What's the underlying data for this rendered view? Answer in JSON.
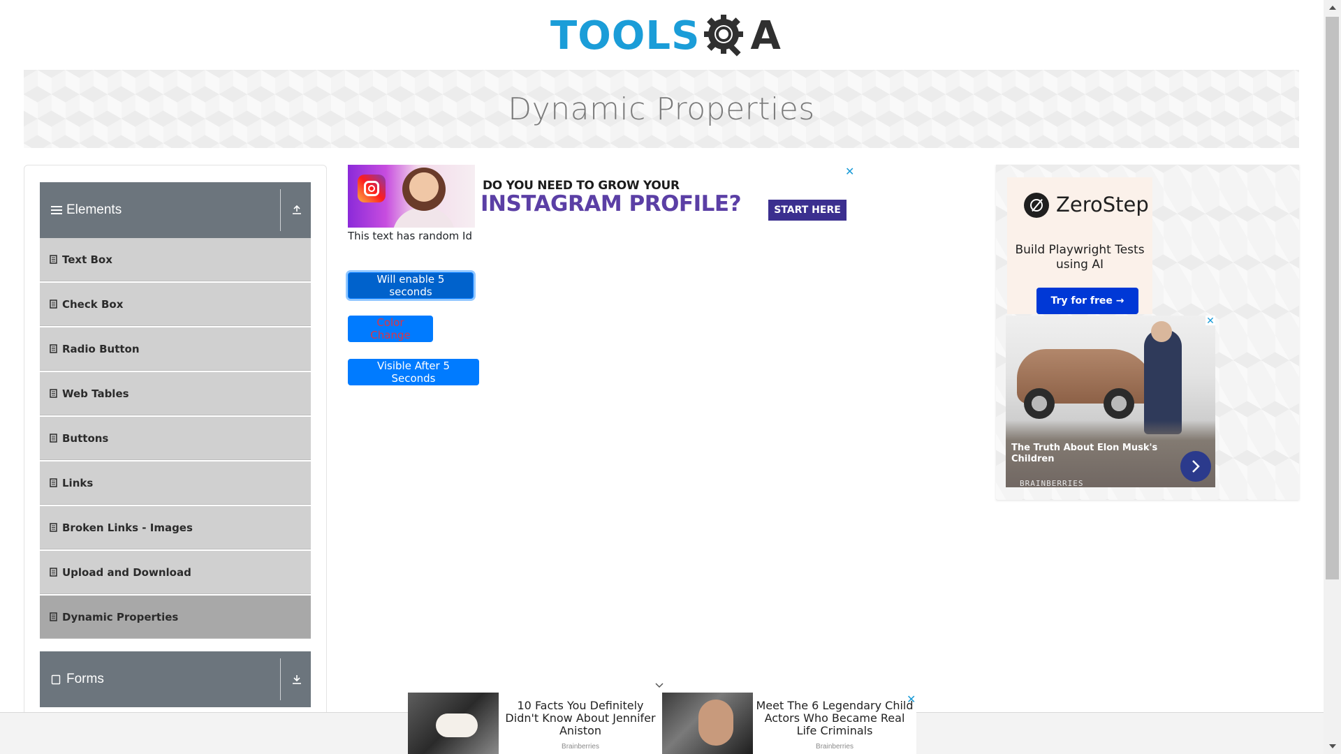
{
  "header": {
    "logo_tools": "TOOLS",
    "logo_qa_a": "A"
  },
  "banner": {
    "title": "Dynamic Properties"
  },
  "sidebar": {
    "elements_group": {
      "title": "Elements",
      "icon": "hamburger-icon",
      "toggle_icon": "collapse-up-icon"
    },
    "items": [
      {
        "label": "Text Box",
        "icon": "file-icon",
        "active": false
      },
      {
        "label": "Check Box",
        "icon": "file-icon",
        "active": false
      },
      {
        "label": "Radio Button",
        "icon": "file-icon",
        "active": false
      },
      {
        "label": "Web Tables",
        "icon": "file-icon",
        "active": false
      },
      {
        "label": "Buttons",
        "icon": "file-icon",
        "active": false
      },
      {
        "label": "Links",
        "icon": "file-icon",
        "active": false
      },
      {
        "label": "Broken Links - Images",
        "icon": "file-icon",
        "active": false
      },
      {
        "label": "Upload and Download",
        "icon": "file-icon",
        "active": false
      },
      {
        "label": "Dynamic Properties",
        "icon": "file-icon",
        "active": true
      }
    ],
    "forms_group": {
      "title": "Forms",
      "icon": "forms-icon",
      "toggle_icon": "expand-down-icon"
    }
  },
  "main": {
    "ad_top": {
      "small_text": "DO YOU NEED TO GROW YOUR",
      "big_text": "INSTAGRAM PROFILE?",
      "cta": "START HERE",
      "close": "✕"
    },
    "random_id_text": "This text has random Id",
    "buttons": {
      "enable_after": "Will enable 5 seconds",
      "color_change": "Color Change",
      "visible_after": "Visible After 5 Seconds"
    }
  },
  "right_ad": {
    "zerostep_name": "ZeroStep",
    "zerostep_tagline": "Build Playwright Tests using AI",
    "zerostep_cta": "Try for free →",
    "story_caption": "The Truth About Elon Musk's Children",
    "story_source": "BRAINBERRIES",
    "close": "✕"
  },
  "bottom_ad": {
    "tile1_title": "10 Facts You Definitely Didn't Know About Jennifer Aniston",
    "tile1_source": "Brainberries",
    "tile2_title": "Meet The 6 Legendary Child Actors Who Became Real Life Criminals",
    "tile2_source": "Brainberries",
    "close": "✕"
  },
  "colors": {
    "primary": "#007bff",
    "primary_active": "#0062cc",
    "danger_text": "#dc3545",
    "sidebar_header": "#6c757d",
    "sidebar_item": "#d0d0d0",
    "sidebar_item_active": "#a8a8a8",
    "logo_blue": "#1b9dd8"
  }
}
